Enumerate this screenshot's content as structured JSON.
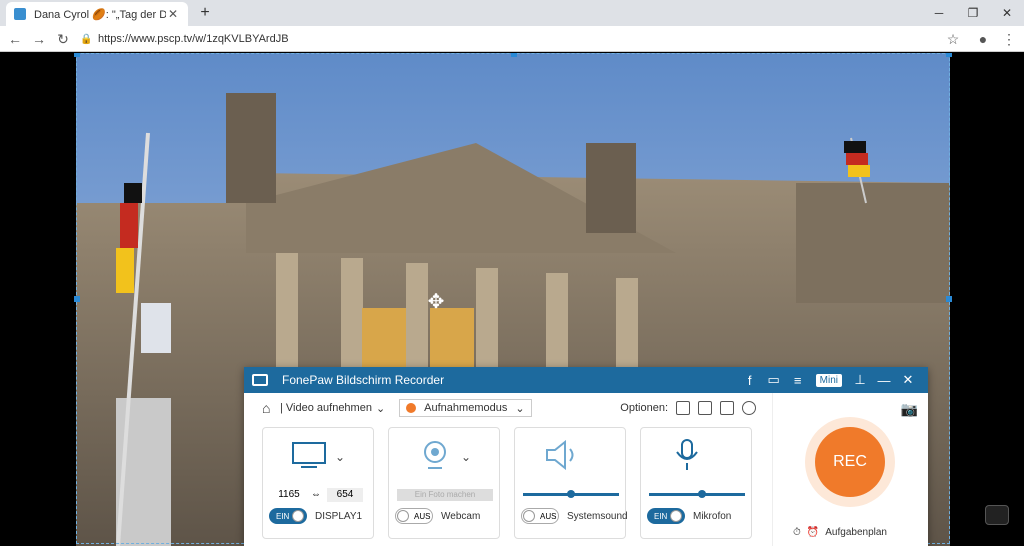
{
  "browser": {
    "tab_title": "Dana Cyrol 🏉: \"„Tag der Deutsch…",
    "new_tab": "+",
    "url": "https://www.pscp.tv/w/1zqKVLBYArdJB",
    "minimize": "─",
    "restore": "❐",
    "close": "✕"
  },
  "recorder": {
    "title": "FonePaw Bildschirm Recorder",
    "mini_label": "Mini",
    "video_label": "| Video aufnehmen",
    "mode_label": "Aufnahmemodus",
    "options_label": "Optionen:",
    "display": {
      "width": "1165",
      "height": "654",
      "toggle": "EIN",
      "label": "DISPLAY1"
    },
    "webcam": {
      "snap_label": "Ein Foto machen",
      "toggle": "AUS",
      "label": "Webcam"
    },
    "systemsound": {
      "toggle": "AUS",
      "label": "Systemsound",
      "volume": 0.5
    },
    "mic": {
      "toggle": "EIN",
      "label": "Mikrofon",
      "volume": 0.55
    },
    "rec_label": "REC",
    "schedule_label": "Aufgabenplan"
  },
  "colors": {
    "accent": "#1d6a9e",
    "rec": "#f07a2a"
  }
}
